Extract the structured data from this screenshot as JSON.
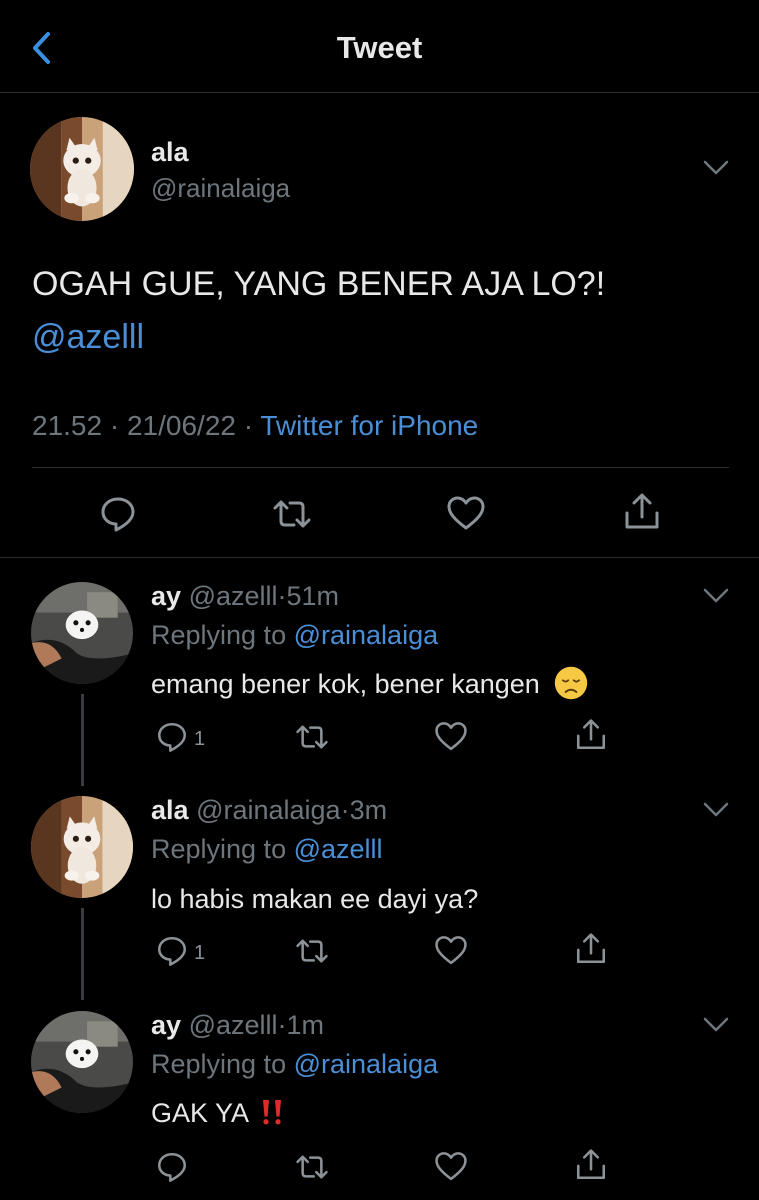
{
  "header": {
    "title": "Tweet",
    "back_icon": "chevron-left-icon"
  },
  "main_tweet": {
    "name": "ala",
    "handle": "@rainalaiga",
    "text": "OGAH GUE, YANG BENER AJA LO?!",
    "mention": "@azelll",
    "time": "21.52",
    "date": "21/06/22",
    "sep": "·",
    "source": "Twitter for iPhone",
    "actions": [
      "reply-icon",
      "retweet-icon",
      "like-icon",
      "share-icon"
    ]
  },
  "replies": [
    {
      "name": "ay",
      "handle": "@azelll",
      "time": "51m",
      "replying_label": "Replying to",
      "replying_to": "@rainalaiga",
      "text": "emang bener kok, bener kangen",
      "emoji": "disappointed-face-emoji",
      "reply_count": "1"
    },
    {
      "name": "ala",
      "handle": "@rainalaiga",
      "time": "3m",
      "replying_label": "Replying to",
      "replying_to": "@azelll",
      "text": "lo habis makan ee dayi ya?",
      "reply_count": "1"
    },
    {
      "name": "ay",
      "handle": "@azelll",
      "time": "1m",
      "replying_label": "Replying to",
      "replying_to": "@rainalaiga",
      "text": "GAK YA",
      "emoji": "double-exclamation-emoji",
      "reply_count": ""
    }
  ],
  "colors": {
    "background": "#000000",
    "link": "#4a8fd6",
    "secondary_text": "#6e767d",
    "primary_text": "#e8e8e8",
    "divider": "#2a2d30"
  }
}
